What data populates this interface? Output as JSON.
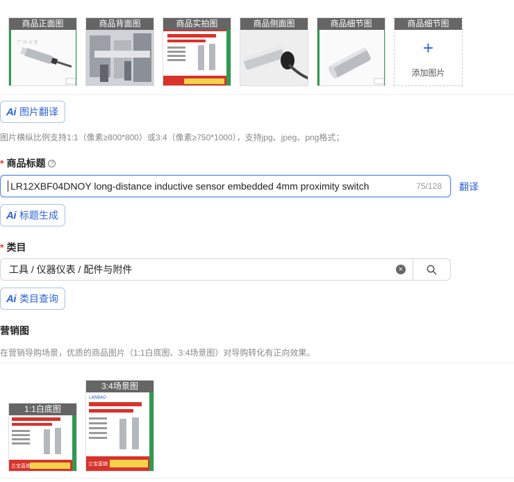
{
  "product_images": [
    {
      "label": "商品正面图"
    },
    {
      "label": "商品背面图"
    },
    {
      "label": "商品实拍图"
    },
    {
      "label": "商品侧面图"
    },
    {
      "label": "商品细节图"
    }
  ],
  "add_image": {
    "label": "商品细节图",
    "text": "添加图片"
  },
  "image_translate_btn": "图片翻译",
  "image_hint": "图片横纵比例支持1:1（像素≥800*800）或3:4（像素≥750*1000），支持jpg、jpeg、png格式；",
  "title_section": {
    "required_mark": "*",
    "label": "商品标题",
    "help_icon": "question-circle-icon",
    "value": "LR12XBF04DNOY long-distance inductive sensor embedded 4mm proximity switch",
    "count": "75/128",
    "translate_link": "翻译",
    "generate_btn": "标题生成"
  },
  "category_section": {
    "required_mark": "*",
    "label": "类目",
    "value": "工具 / 仪器仪表 / 配件与附件",
    "query_btn": "类目查询"
  },
  "marketing_section": {
    "label": "营销图",
    "hint": "在营销导购场景，优质的商品图片（1:1白底图、3:4场景图）对导购转化有正向效果。",
    "images": [
      {
        "label": "1:1白底图"
      },
      {
        "label": "3:4场景图"
      }
    ]
  },
  "poster_text": {
    "headline": "M12远距离电感接近开关",
    "subline": "LR12XB-Y-直流3/4线系列",
    "brand": "兰宝直销",
    "logo": "LANBAO"
  },
  "colors": {
    "accent": "#2e64d6",
    "required": "#e53935",
    "poster_red": "#d8322c",
    "poster_green": "#2f9a4f"
  }
}
